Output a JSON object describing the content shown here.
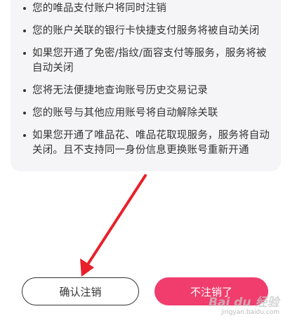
{
  "notice": {
    "items": [
      "您的唯品支付账户将同时注销",
      "您的账户关联的银行卡快捷支付服务将被自动关闭",
      "如果您开通了免密/指纹/面容支付等服务，服务将被自动关闭",
      "您将无法便捷地查询账号历史交易记录",
      "您的账号与其他应用账号将自动解除关联",
      "如果您开通了唯品花、唯品花取现服务，服务将自动关闭。且不支持同一身份信息更换账号重新开通"
    ]
  },
  "actions": {
    "confirm_label": "确认注销",
    "cancel_label": "不注销了"
  },
  "watermark": {
    "logo": "Bai du 经验",
    "url": "jingyan.baidu.com"
  },
  "colors": {
    "primary": "#f03d6e",
    "card_bg": "#f5f5f7",
    "arrow": "#e8202a"
  }
}
